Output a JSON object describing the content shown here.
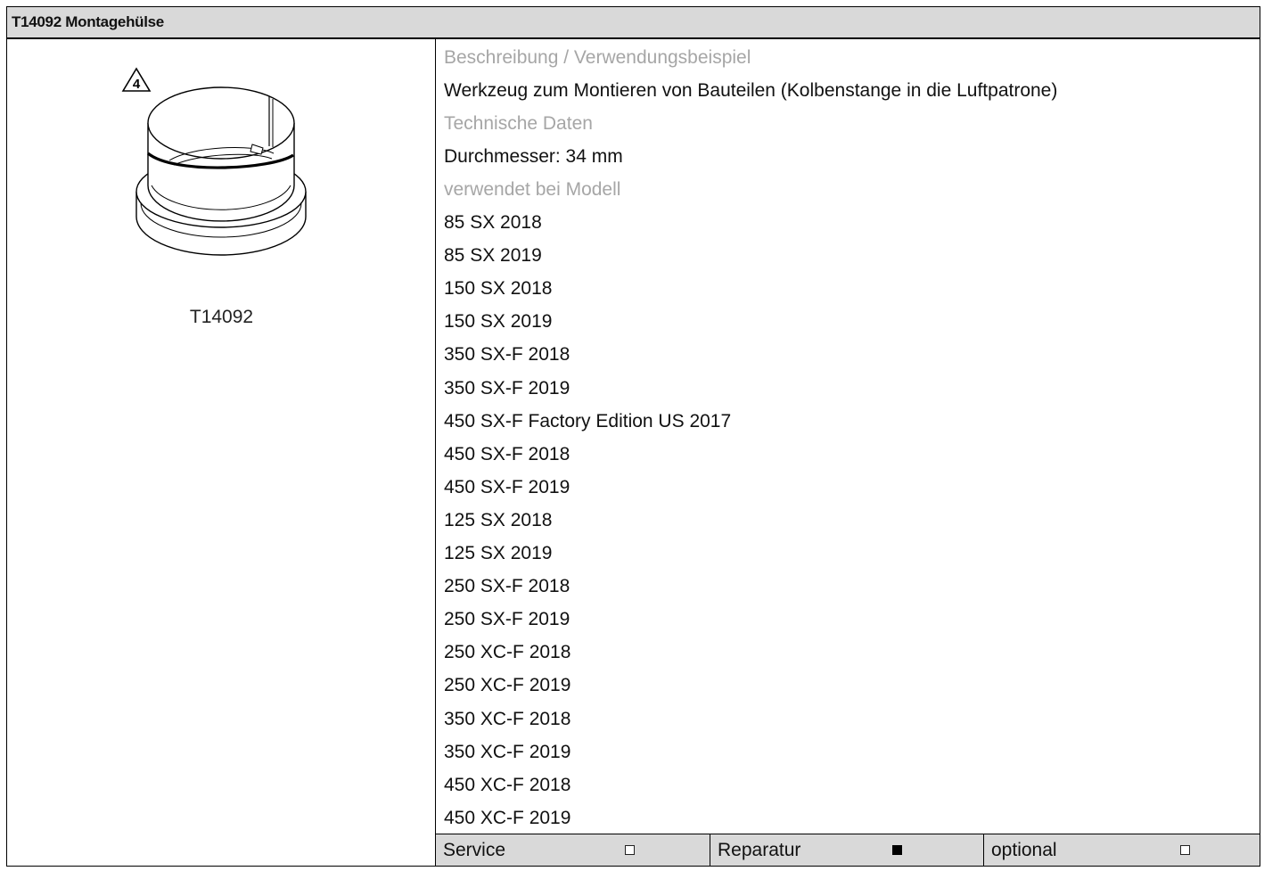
{
  "header": {
    "title": "T14092 Montagehülse"
  },
  "tool": {
    "number": "T14092",
    "figure_badge": "4"
  },
  "details": {
    "description_label": "Beschreibung / Verwendungsbeispiel",
    "description": "Werkzeug zum Montieren von Bauteilen (Kolbenstange in die Luftpatrone)",
    "tech_label": "Technische Daten",
    "tech_value": "Durchmesser: 34 mm",
    "models_label": "verwendet bei Modell",
    "models": [
      "85 SX 2018",
      "85 SX 2019",
      "150 SX 2018",
      "150 SX 2019",
      "350 SX-F 2018",
      "350 SX-F 2019",
      "450 SX-F Factory Edition US 2017",
      "450 SX-F 2018",
      "450 SX-F 2019",
      "125 SX 2018",
      "125 SX 2019",
      "250 SX-F 2018",
      "250 SX-F 2019",
      "250 XC-F 2018",
      "250 XC-F 2019",
      "350 XC-F 2018",
      "350 XC-F 2019",
      "450 XC-F 2018",
      "450 XC-F 2019"
    ]
  },
  "footer": {
    "options": [
      {
        "label": "Service",
        "checked": false
      },
      {
        "label": "Reparatur",
        "checked": true
      },
      {
        "label": "optional",
        "checked": false
      }
    ]
  }
}
